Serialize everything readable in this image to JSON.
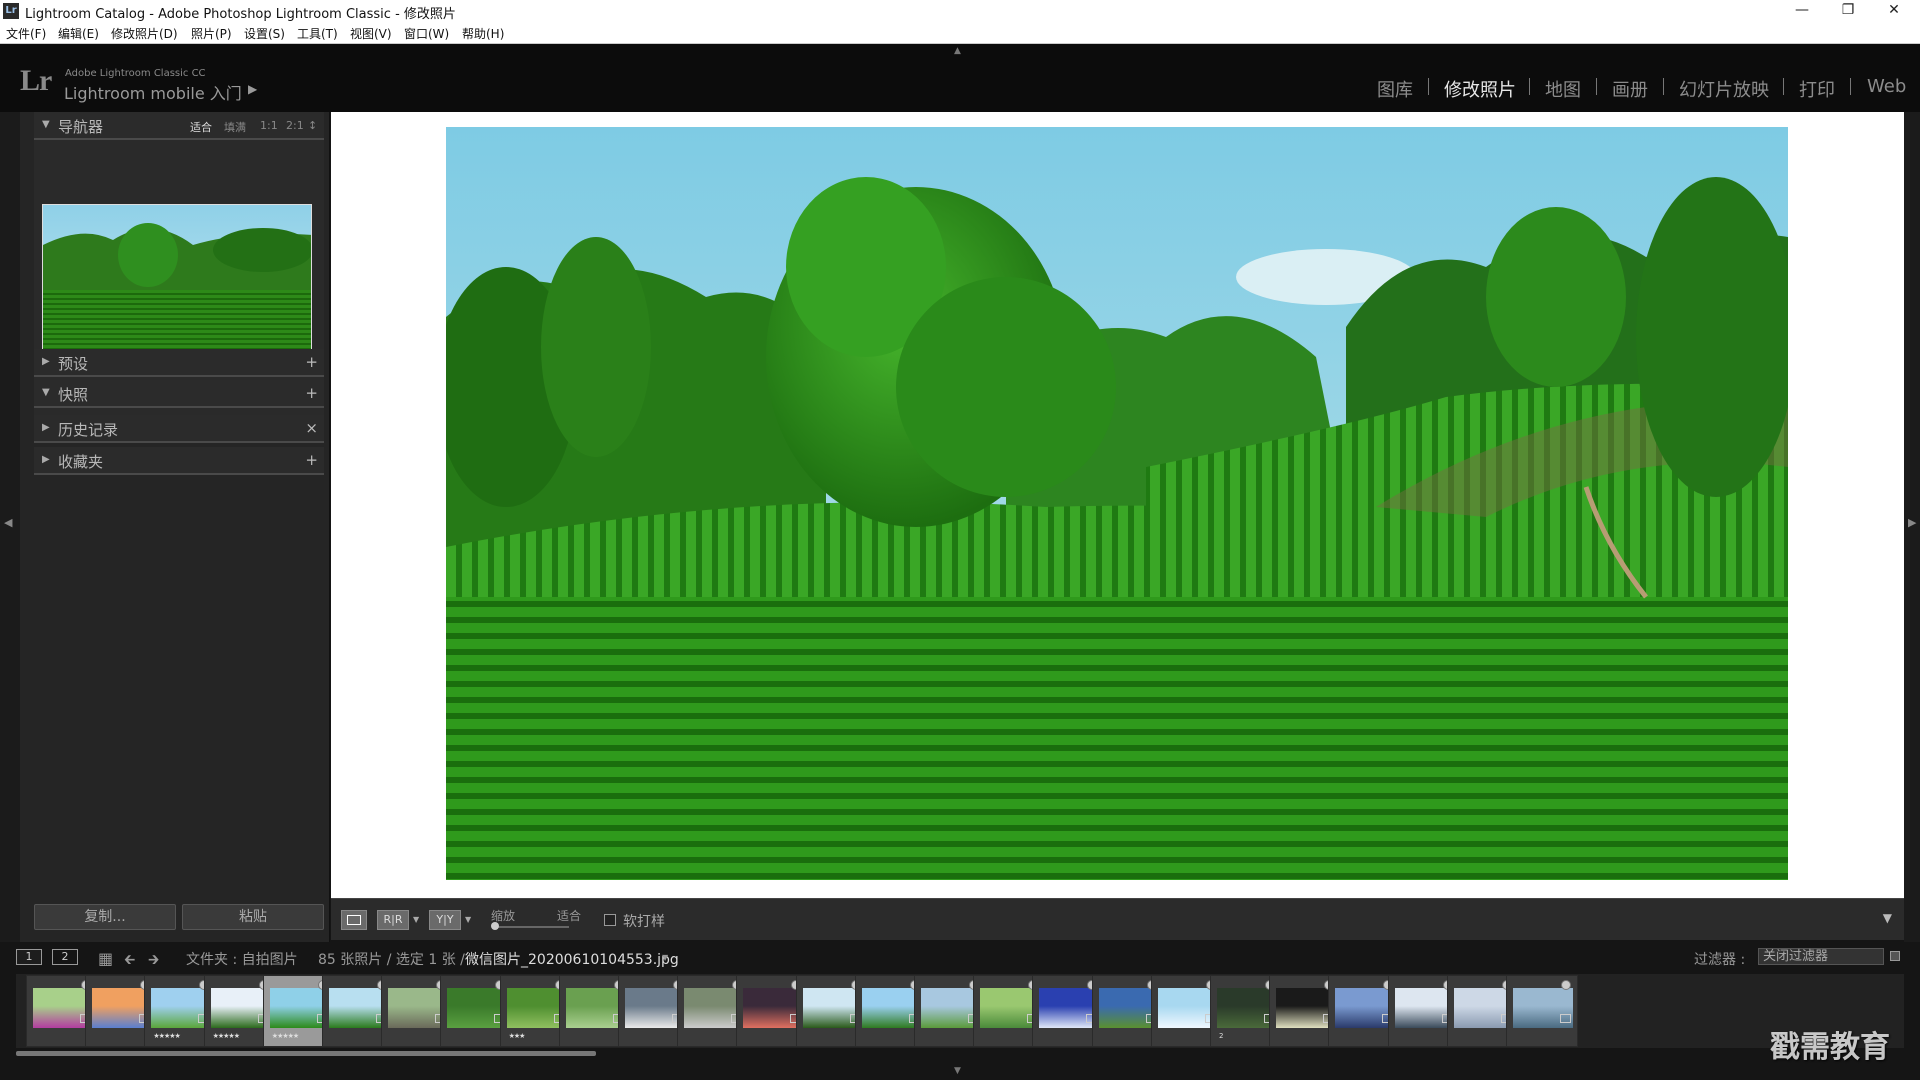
{
  "window": {
    "app_icon": "Lr",
    "title": "Lightroom Catalog - Adobe Photoshop Lightroom Classic - 修改照片",
    "controls": [
      "minimize-icon",
      "restore-icon",
      "close-icon"
    ]
  },
  "menu": [
    "文件(F)",
    "编辑(E)",
    "修改照片(D)",
    "照片(P)",
    "设置(S)",
    "工具(T)",
    "视图(V)",
    "窗口(W)",
    "帮助(H)"
  ],
  "identity": {
    "logo": "Lr",
    "product": "Adobe Lightroom Classic CC",
    "mobile": "Lightroom mobile 入门"
  },
  "modules": [
    "图库",
    "修改照片",
    "地图",
    "画册",
    "幻灯片放映",
    "打印",
    "Web"
  ],
  "active_module": "修改照片",
  "left_panel": {
    "navigator": {
      "title": "导航器",
      "zoom": [
        "适合",
        "填满",
        "1:1",
        "2:1"
      ]
    },
    "presets": {
      "title": "预设",
      "action": "+"
    },
    "snapshots": {
      "title": "快照",
      "action": "+"
    },
    "history": {
      "title": "历史记录",
      "action": "×"
    },
    "collections": {
      "title": "收藏夹",
      "action": "+"
    },
    "copy_button": "复制...",
    "paste_button": "粘贴"
  },
  "toolbar": {
    "view_modes": [
      "",
      "R|R",
      "Y|Y"
    ],
    "zoom_label": "缩放",
    "fit_label": "适合",
    "soft_proof": "软打样",
    "soft_proof_checked": false
  },
  "filmstrip_bar": {
    "page1": "1",
    "page2": "2",
    "folder": "文件夹 : 自拍图片",
    "count": "85 张照片 / 选定 1 张 /",
    "filename": "微信图片_20200610104553.jpg",
    "filter_label": "过滤器 :",
    "filter_value": "关闭过滤器"
  },
  "filmstrip": [
    {
      "stars": ""
    },
    {
      "stars": ""
    },
    {
      "stars": "★★★★★"
    },
    {
      "stars": "★★★★★"
    },
    {
      "stars": "★★★★★",
      "selected": true
    },
    {
      "stars": ""
    },
    {
      "stars": ""
    },
    {
      "stars": ""
    },
    {
      "stars": "★★★"
    },
    {
      "stars": ""
    },
    {
      "stars": ""
    },
    {
      "stars": ""
    },
    {
      "stars": ""
    },
    {
      "stars": ""
    },
    {
      "stars": ""
    },
    {
      "stars": ""
    },
    {
      "stars": ""
    },
    {
      "stars": ""
    },
    {
      "stars": ""
    },
    {
      "stars": ""
    },
    {
      "stars": "2"
    },
    {
      "stars": ""
    },
    {
      "stars": ""
    },
    {
      "stars": ""
    },
    {
      "stars": ""
    },
    {
      "stars": ""
    }
  ],
  "watermark": "戳需教育",
  "colors": {
    "bg": "#151515",
    "panel": "#252525",
    "active_module": "#e6e6e6",
    "inactive_module": "#8c8c8c"
  }
}
